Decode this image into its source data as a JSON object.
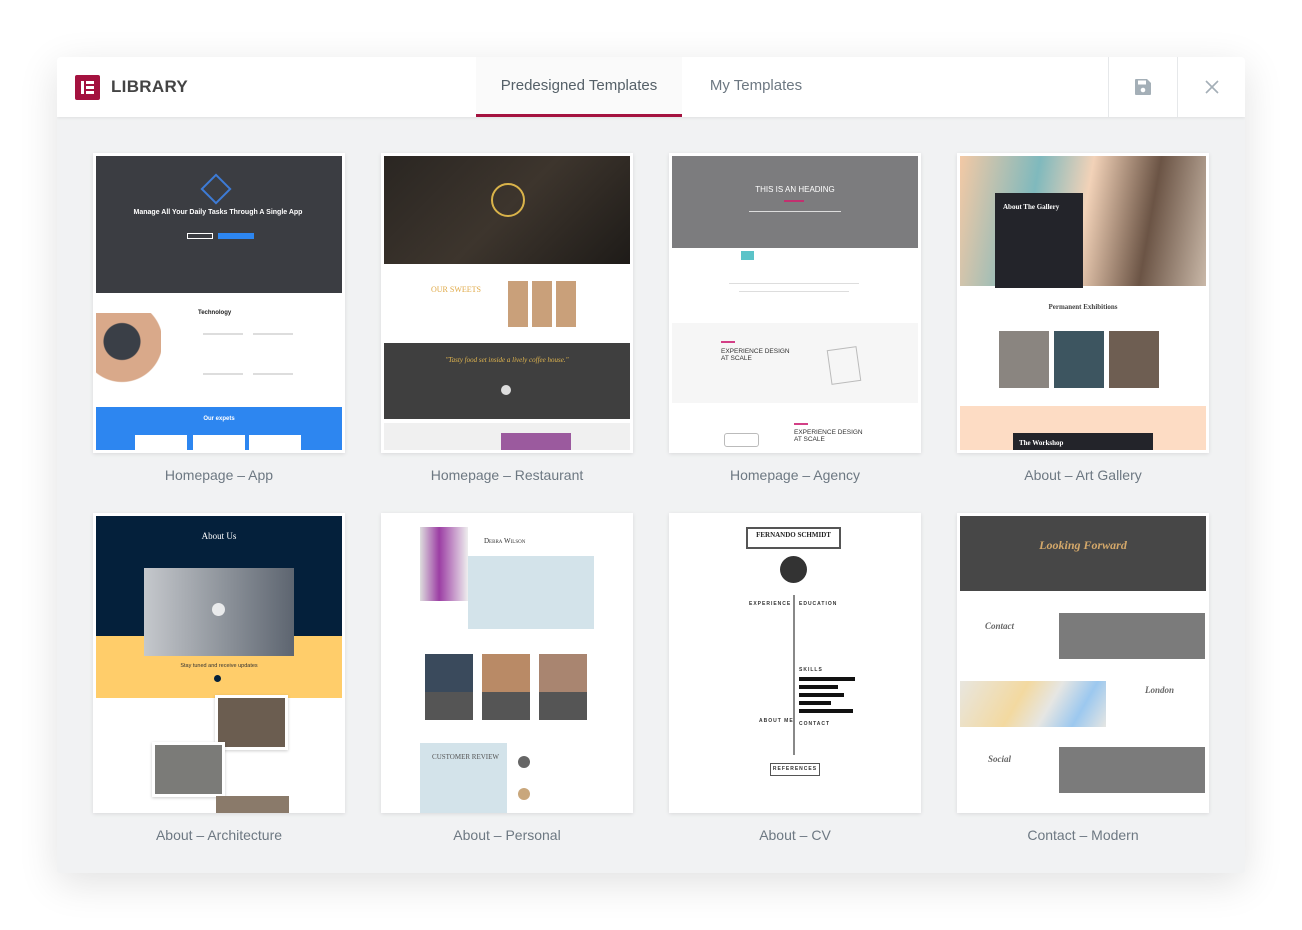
{
  "header": {
    "title": "LIBRARY",
    "logo_icon": "elementor-logo-icon",
    "tabs": [
      {
        "label": "Predesigned Templates",
        "active": true
      },
      {
        "label": "My Templates",
        "active": false
      }
    ],
    "save_icon": "save-icon",
    "close_icon": "close-icon"
  },
  "colors": {
    "accent": "#a4123f",
    "background": "#f1f2f3",
    "label": "#6d7882"
  },
  "templates": [
    {
      "label": "Homepage – App",
      "preview": {
        "heading": "Manage All Your Daily Tasks Through A Single App",
        "section": "Technology",
        "footer": "Our expets"
      }
    },
    {
      "label": "Homepage – Restaurant",
      "preview": {
        "heading": "OUR SWEETS",
        "quote": "\"Tasty food set inside a lively coffee house.\""
      }
    },
    {
      "label": "Homepage – Agency",
      "preview": {
        "heading": "THIS IS AN HEADING",
        "section": "EXPERIENCE DESIGN AT SCALE",
        "section2": "EXPERIENCE DESIGN AT SCALE"
      }
    },
    {
      "label": "About – Art Gallery",
      "preview": {
        "heading": "About The Gallery",
        "section": "Permanent Exhibitions",
        "footer": "The Workshop"
      }
    },
    {
      "label": "About – Architecture",
      "preview": {
        "heading": "About Us",
        "section": "Stay tuned and receive updates"
      }
    },
    {
      "label": "About – Personal",
      "preview": {
        "heading": "Debra Wilson",
        "section": "CUSTOMER REVIEW"
      }
    },
    {
      "label": "About – CV",
      "preview": {
        "heading": "FERNANDO SCHMIDT",
        "section": "EXPERIENCE",
        "section2": "EDUCATION",
        "section3": "SKILLS",
        "section4": "ABOUT ME",
        "section5": "CONTACT",
        "footer": "REFERENCES"
      }
    },
    {
      "label": "Contact – Modern",
      "preview": {
        "heading": "Looking Forward",
        "section": "Contact",
        "section2": "London",
        "section3": "Social"
      }
    }
  ]
}
